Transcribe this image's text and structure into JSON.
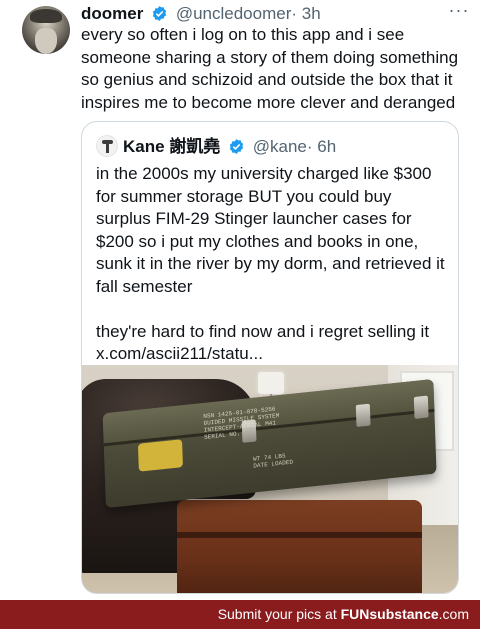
{
  "tweet": {
    "author_name": "doomer",
    "author_handle": "@uncledoomer",
    "time": "· 3h",
    "more_icon": "more-dots-icon",
    "text": "every so often i log on to this app and i see someone sharing a story of them doing something so genius and schizoid and outside the box that it inspires me to become more clever and deranged"
  },
  "quote": {
    "author_name": "Kane 謝凱堯",
    "author_handle": "@kane",
    "time": "· 6h",
    "text": "in the 2000s my university charged like $300 for summer storage BUT you could buy surplus FIM-29 Stinger launcher cases for $200 so i put my clothes and books in one, sunk it in the river by my dorm, and retrieved it fall semester\n\nthey're hard to find now and i regret selling it x.com/ascii211/statu...",
    "image_stencil_1": "NSN 1425-01-078-5256\nGUIDED MISSILE SYSTEM\nINTERCEPT-AERIAL M41\nSERIAL NO.",
    "image_stencil_2": "WT 74 LBS\nDATE LOADED"
  },
  "footer": {
    "prefix": "Submit your pics at ",
    "brand": "FUNsubstance",
    "suffix": ".com"
  },
  "colors": {
    "verified_blue": "#1d9bf0",
    "footer_bg": "#8a1c1e",
    "handle_gray": "#536471"
  }
}
